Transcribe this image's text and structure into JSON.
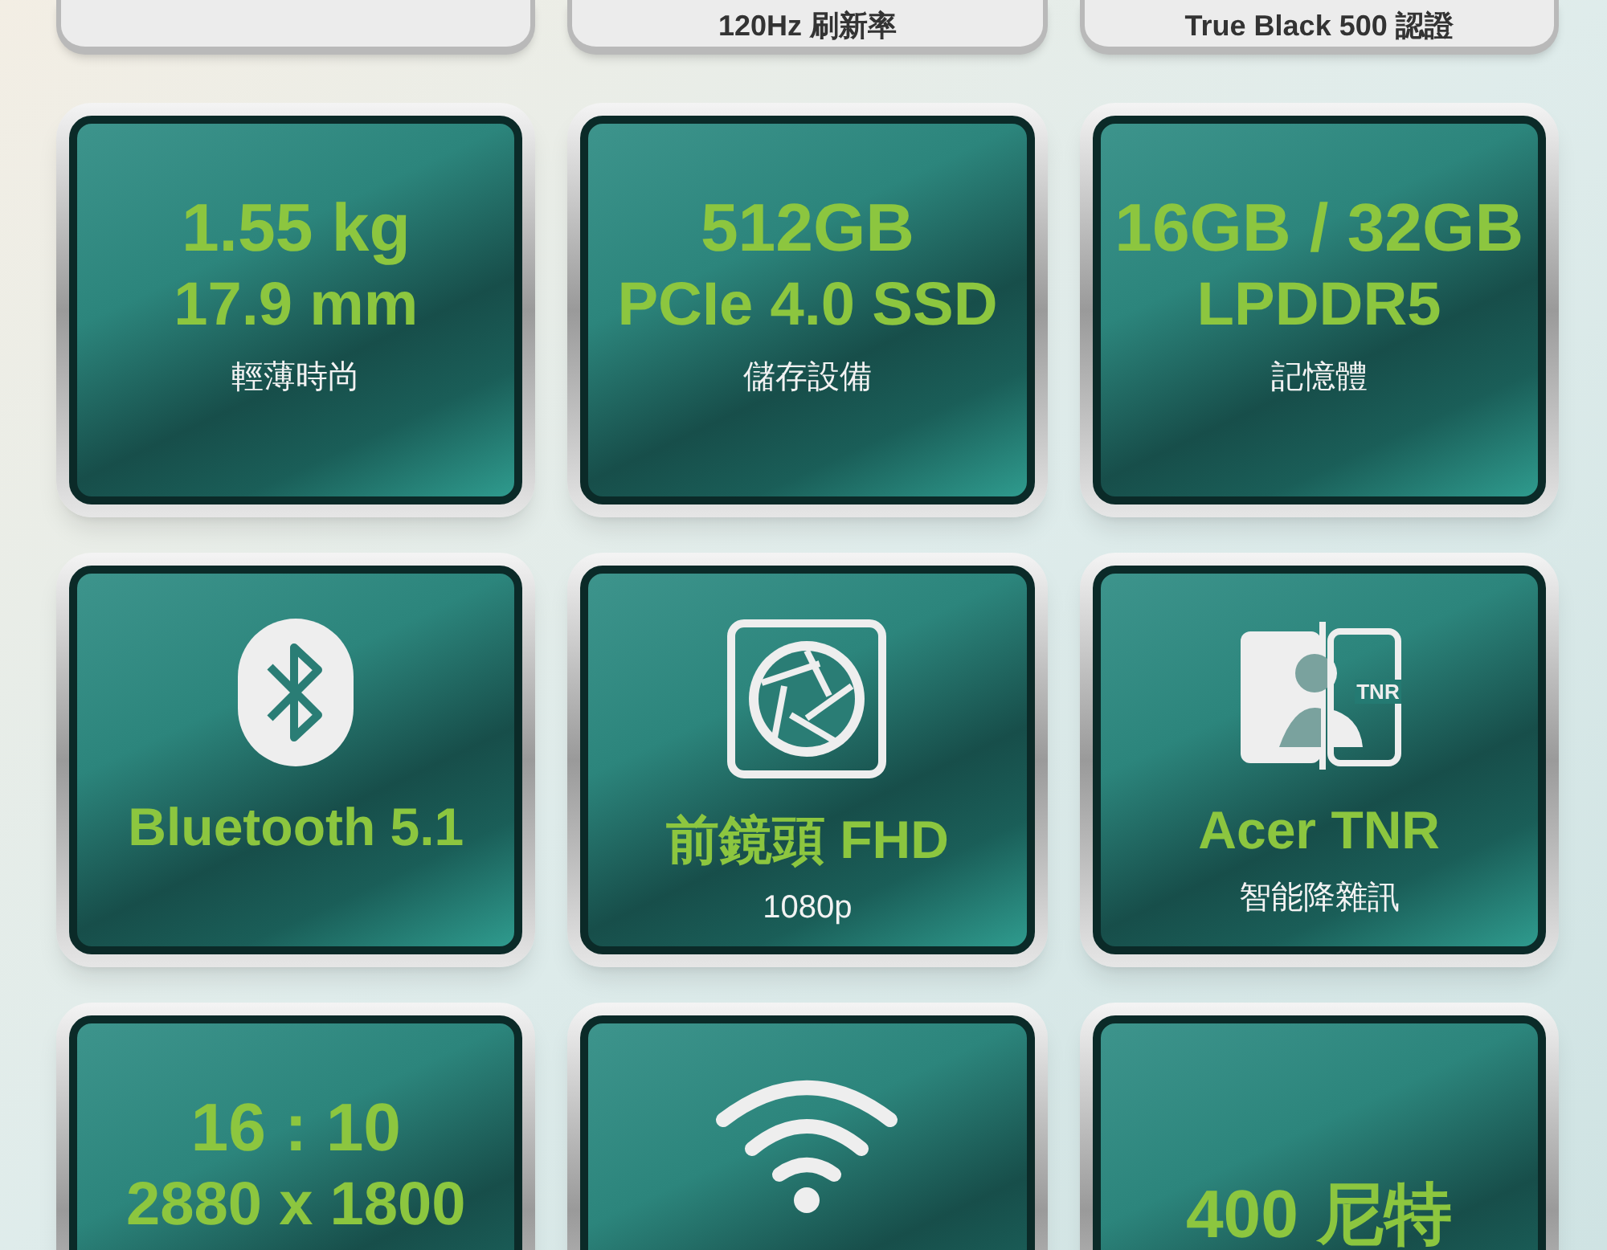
{
  "top_row": [
    {
      "kind": "blank"
    },
    {
      "kind": "label",
      "label": "120Hz 刷新率"
    },
    {
      "kind": "label",
      "label": "True Black 500 認證"
    }
  ],
  "tiles": [
    {
      "kind": "text",
      "headline": [
        "1.55 kg",
        "17.9 mm"
      ],
      "caption": "輕薄時尚"
    },
    {
      "kind": "text",
      "headline": [
        "512GB",
        "PCIe 4.0 SSD"
      ],
      "caption": "儲存設備"
    },
    {
      "kind": "text",
      "headline": [
        "16GB / 32GB",
        "LPDDR5"
      ],
      "caption": "記憶體"
    },
    {
      "kind": "bluetooth",
      "headline": [
        "Bluetooth 5.1"
      ]
    },
    {
      "kind": "camera",
      "headline": [
        "前鏡頭 FHD"
      ],
      "caption": "1080p"
    },
    {
      "kind": "tnr",
      "headline": [
        "Acer TNR"
      ],
      "caption": "智能降雜訊",
      "badge": "TNR"
    },
    {
      "kind": "text",
      "headline": [
        "16 : 10",
        "2880 x 1800"
      ]
    },
    {
      "kind": "wifi"
    },
    {
      "kind": "text",
      "headline": [
        "400 尼特"
      ]
    }
  ]
}
